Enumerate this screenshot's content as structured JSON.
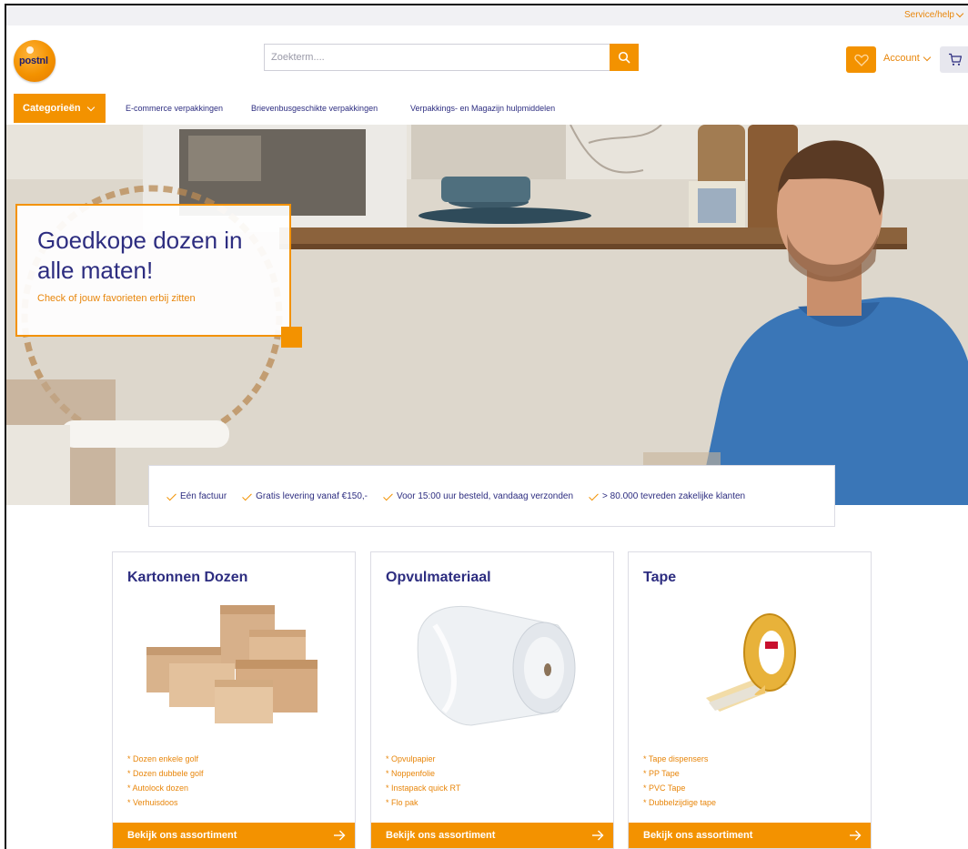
{
  "topbar": {
    "service_label": "Service/help"
  },
  "header": {
    "logo_text": "postnl",
    "search_placeholder": "Zoekterm....",
    "account_label": "Account"
  },
  "nav": {
    "categories_label": "Categorieën",
    "links": [
      "E-commerce verpakkingen",
      "Brievenbusgeschikte verpakkingen",
      "Verpakkings- en Magazijn hulpmiddelen"
    ]
  },
  "hero": {
    "title": "Goedkope dozen in alle maten!",
    "subtitle": "Check of jouw favorieten erbij zitten"
  },
  "usps": [
    "Eén factuur",
    "Gratis levering vanaf €150,-",
    "Voor 15:00 uur besteld, vandaag verzonden",
    "> 80.000 tevreden zakelijke klanten"
  ],
  "cards": [
    {
      "title": "Kartonnen Dozen",
      "items": [
        "* Dozen enkele golf",
        "* Dozen dubbele golf",
        "* Autolock dozen",
        "* Verhuisdoos"
      ],
      "cta": "Bekijk ons assortiment"
    },
    {
      "title": "Opvulmateriaal",
      "items": [
        "* Opvulpapier",
        "* Noppenfolie",
        "* Instapack quick RT",
        "* Flo pak"
      ],
      "cta": "Bekijk ons assortiment"
    },
    {
      "title": "Tape",
      "items": [
        "* Tape dispensers",
        "* PP Tape",
        "* PVC Tape",
        "* Dubbelzijdige tape"
      ],
      "cta": "Bekijk ons assortiment"
    }
  ],
  "colors": {
    "accent": "#f39200",
    "brand_text": "#2d2d80",
    "link_orange": "#e8860b"
  },
  "icons": [
    "search-icon",
    "heart-icon",
    "chevron-down-icon",
    "cart-icon",
    "check-icon",
    "arrow-right-icon"
  ]
}
